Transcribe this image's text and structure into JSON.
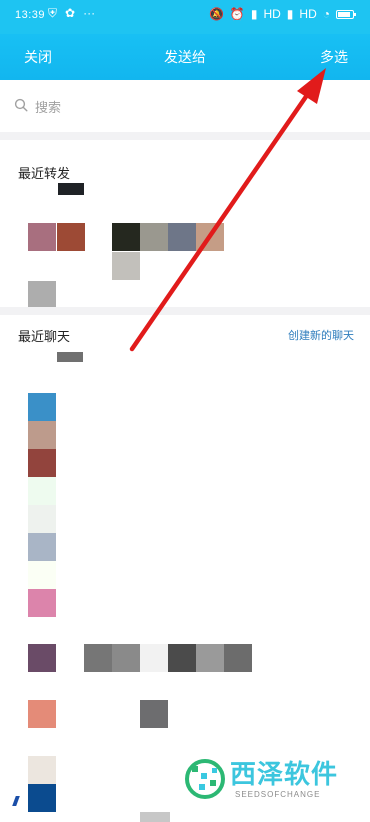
{
  "status_bar": {
    "time": "13:39",
    "left_icons": [
      "shield-icon",
      "flower-icon",
      "dots-icon"
    ],
    "signal_labels": [
      "HD",
      "HD"
    ]
  },
  "header": {
    "close_label": "关闭",
    "title": "发送给",
    "multi_select_label": "多选"
  },
  "search": {
    "placeholder": "搜索"
  },
  "sections": {
    "recent_forward": "最近转发",
    "recent_chat": "最近聊天",
    "create_chat": "创建新的聊天"
  },
  "watermark": {
    "title": "西泽软件",
    "subtitle": "SEEDSOFCHANGE"
  }
}
